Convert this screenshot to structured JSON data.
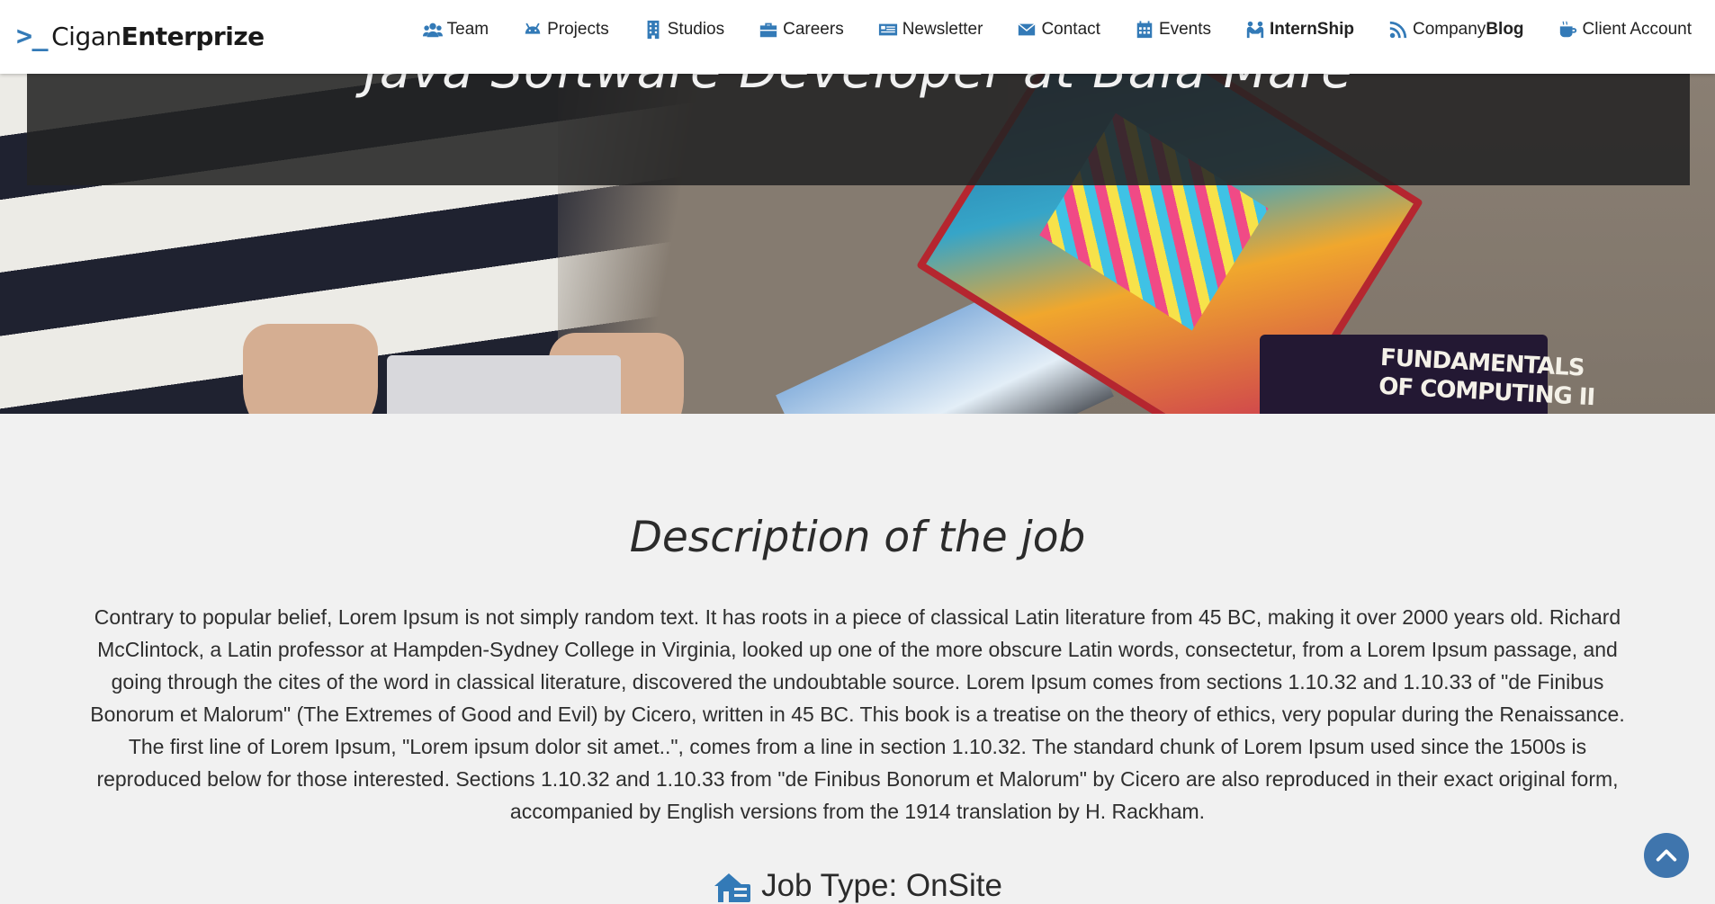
{
  "brand": {
    "prompt": ">_",
    "part1": "Cigan",
    "part2": "Enterprize"
  },
  "nav": {
    "items": [
      {
        "label": "Team",
        "icon": "users-icon"
      },
      {
        "label": "Projects",
        "icon": "android-icon"
      },
      {
        "label": "Studios",
        "icon": "building-icon"
      },
      {
        "label": "Careers",
        "icon": "briefcase-icon"
      },
      {
        "label": "Newsletter",
        "icon": "newspaper-icon"
      },
      {
        "label": "Contact",
        "icon": "envelope-icon"
      },
      {
        "label": "Events",
        "icon": "calendar-icon"
      },
      {
        "label": "InternShip",
        "icon": "handshake-icon"
      },
      {
        "label_part1": "Company",
        "label_part2": "Blog",
        "icon": "feed-icon"
      },
      {
        "label": "Client Account",
        "icon": "coffee-icon"
      }
    ]
  },
  "hero": {
    "title": "Java Software Developer at Baia Mare",
    "book_text_line1": "FUNDAMENTALS",
    "book_text_line2": "OF COMPUTING II"
  },
  "main": {
    "section_title": "Description of the job",
    "description": "Contrary to popular belief, Lorem Ipsum is not simply random text. It has roots in a piece of classical Latin literature from 45 BC, making it over 2000 years old. Richard McClintock, a Latin professor at Hampden-Sydney College in Virginia, looked up one of the more obscure Latin words, consectetur, from a Lorem Ipsum passage, and going through the cites of the word in classical literature, discovered the undoubtable source. Lorem Ipsum comes from sections 1.10.32 and 1.10.33 of \"de Finibus Bonorum et Malorum\" (The Extremes of Good and Evil) by Cicero, written in 45 BC. This book is a treatise on the theory of ethics, very popular during the Renaissance. The first line of Lorem Ipsum, \"Lorem ipsum dolor sit amet..\", comes from a line in section 1.10.32. The standard chunk of Lorem Ipsum used since the 1500s is reproduced below for those interested. Sections 1.10.32 and 1.10.33 from \"de Finibus Bonorum et Malorum\" by Cicero are also reproduced in their exact original form, accompanied by English versions from the 1914 translation by H. Rackham.",
    "job_type": "Job Type: OnSite",
    "job_type_icon": "home-work-icon"
  },
  "colors": {
    "accent": "#337ab7",
    "back_to_top": "#3f75ad",
    "page_bg": "#f1f1f1"
  },
  "back_to_top_icon": "chevron-up-icon"
}
